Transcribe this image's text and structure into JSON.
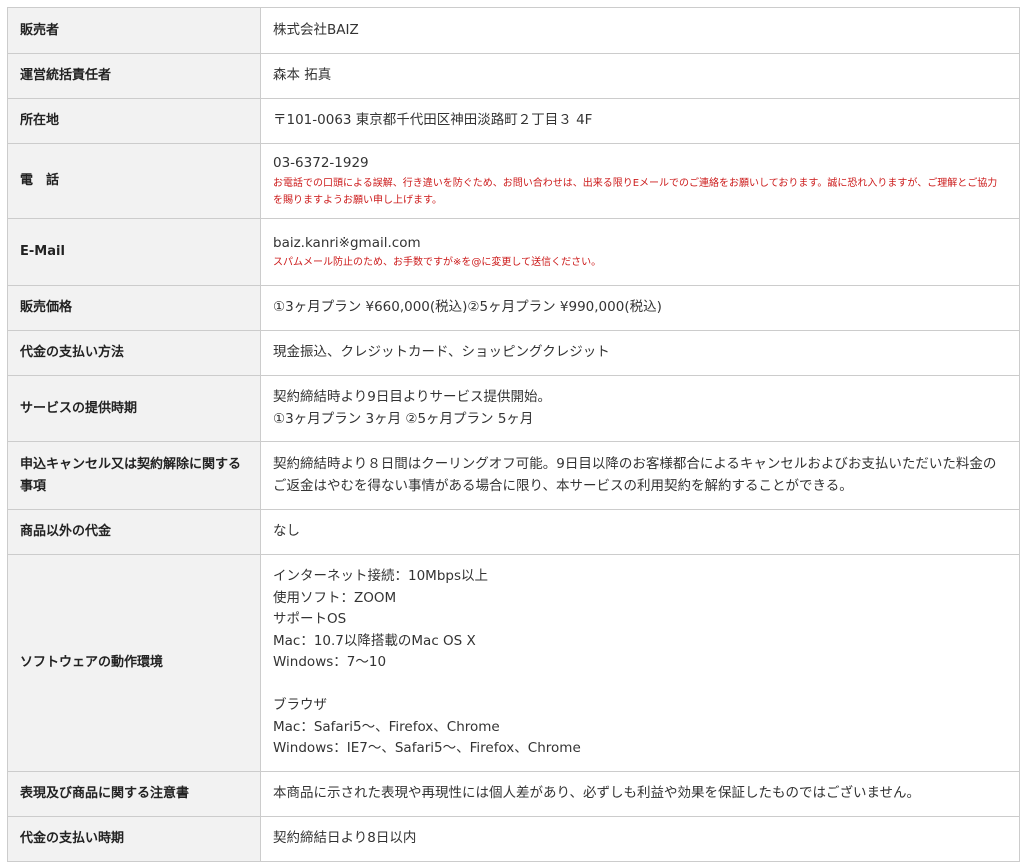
{
  "rows": [
    {
      "label": "販売者",
      "value": "株式会社BAIZ"
    },
    {
      "label": "運営統括責任者",
      "value": "森本 拓真"
    },
    {
      "label": "所在地",
      "value": "〒101-0063 東京都千代田区神田淡路町２丁目３ 4F"
    },
    {
      "label": "電　話",
      "value": "03-6372-1929",
      "note": "お電話での口頭による誤解、行き違いを防ぐため、お問い合わせは、出来る限りEメールでのご連絡をお願いしております。誠に恐れ入りますが、ご理解とご協力を賜りますようお願い申し上げます。"
    },
    {
      "label": "E-Mail",
      "value": "baiz.kanri※gmail.com",
      "note": "スパムメール防止のため、お手数ですが※を@に変更して送信ください。"
    },
    {
      "label": "販売価格",
      "value": "①3ヶ月プラン ¥660,000(税込)②5ヶ月プラン ¥990,000(税込)"
    },
    {
      "label": "代金の支払い方法",
      "value": "現金振込、クレジットカード、ショッピングクレジット"
    },
    {
      "label": "サービスの提供時期",
      "lines": [
        "契約締結時より9日目よりサービス提供開始。",
        "①3ヶ月プラン 3ヶ月 ②5ヶ月プラン 5ヶ月"
      ]
    },
    {
      "label": "申込キャンセル又は契約解除に関する事項",
      "value": "契約締結時より８日間はクーリングオフ可能。9日目以降のお客様都合によるキャンセルおよびお支払いただいた料金のご返金はやむを得ない事情がある場合に限り、本サービスの利用契約を解約することができる。"
    },
    {
      "label": "商品以外の代金",
      "value": "なし"
    },
    {
      "label": "ソフトウェアの動作環境",
      "lines": [
        "インターネット接続：10Mbps以上",
        "使用ソフト：ZOOM",
        "サポートOS",
        "Mac：10.7以降搭載のMac OS X",
        "Windows：7～10",
        "",
        "ブラウザ",
        "Mac：Safari5～、Firefox、Chrome",
        "Windows：IE7～、Safari5～、Firefox、Chrome"
      ]
    },
    {
      "label": "表現及び商品に関する注意書",
      "value": "本商品に示された表現や再現性には個人差があり、必ずしも利益や効果を保証したものではございません。"
    },
    {
      "label": "代金の支払い時期",
      "value": "契約締結日より8日以内"
    }
  ]
}
